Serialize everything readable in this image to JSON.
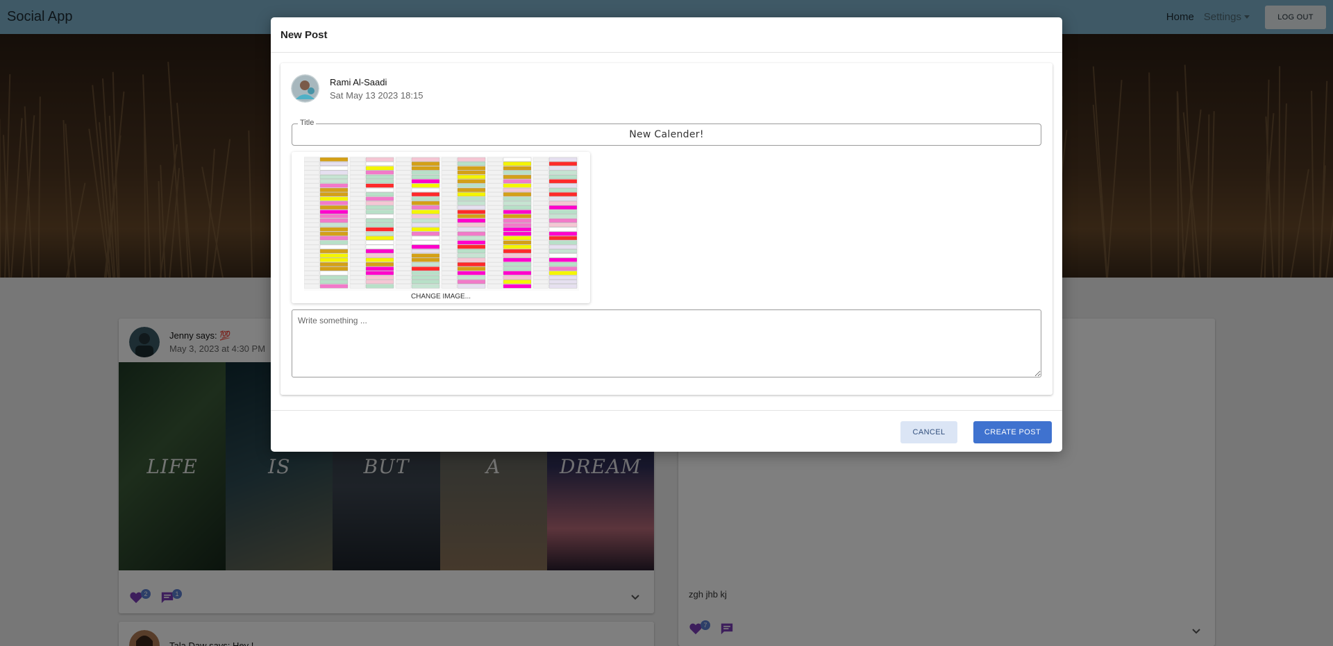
{
  "navbar": {
    "brand": "Social App",
    "home": "Home",
    "settings": "Settings",
    "logout": "LOG OUT"
  },
  "feed": {
    "post1": {
      "author_line": "Jenny says: 💯",
      "date": "May 3, 2023 at 4:30 PM",
      "image_words": [
        "LIFE",
        "IS",
        "BUT",
        "A",
        "DREAM"
      ],
      "likes": "2",
      "comments": "1"
    },
    "post2": {
      "text": "zgh jhb kj",
      "likes": "7"
    },
    "post3": {
      "author_line": "Tala Daw says: Hey !"
    }
  },
  "modal": {
    "title": "New Post",
    "author": "Rami Al-Saadi",
    "date": "Sat May 13 2023 18:15",
    "title_label": "Title",
    "title_value": "New Calender!",
    "change_image": "CHANGE IMAGE...",
    "body_placeholder": "Write something ...",
    "cancel": "CANCEL",
    "create": "CREATE POST"
  },
  "colors": {
    "navbar": "#7fb3cc",
    "primary_button": "#3f72cf",
    "cancel_button": "#dbe5f5",
    "like_icon": "#7a3db8",
    "comment_icon": "#7a3db8",
    "badge": "#5b7fd0"
  },
  "icons": {
    "like": "heart-icon",
    "comment": "comment-icon",
    "expand": "chevron-down-icon",
    "settings_caret": "caret-down-icon"
  }
}
